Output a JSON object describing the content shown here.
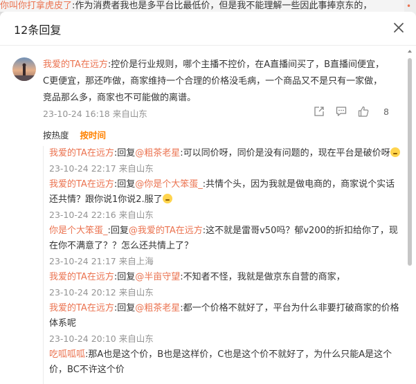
{
  "background": {
    "top_strip_name": "你叫你打拿虎皮了",
    "top_strip_text": ":作为消费者我也是多平台比最低价，但是我不能理解一些因此事捧京东的，"
  },
  "dialog": {
    "title": "12条回复"
  },
  "main_comment": {
    "user": "我爱的TA在远方",
    "text": ":控价是行业规则，哪个主播不控价，在A直播间买了，B直播间便宜，C更便宜，那还咋做，商家维持一个合理的价格没毛病，一个商品又不是只有一家做，竞品那么多，商家也不可能做的离谱。",
    "time": "23-10-24 16:18 来自山东",
    "like_count": "8"
  },
  "sort": {
    "hot_label": "按热度",
    "time_label": "按时间"
  },
  "replies": [
    {
      "user": "我爱的TA在远方",
      "reply_word": ":回复",
      "target": "@粗茶老星",
      "text": ":可以同价呀，同价是没有问题的，现在平台是破价呀",
      "emoji": true,
      "time": "23-10-24 22:17 来自山东"
    },
    {
      "user": "我爱的TA在远方",
      "reply_word": ":回复",
      "target": "@你是个大笨蛋_",
      "text": ":共情个头，因为我就是做电商的，商家说个实话还共情？跟你说1你说2.服了",
      "emoji": true,
      "time": "23-10-24 22:16 来自山东"
    },
    {
      "user": "你是个大笨蛋_",
      "reply_word": ":回复",
      "target": "@我爱的TA在远方",
      "text": ":这不就是雷哥v50吗？郁v200的折扣给你了，现在你不满意了？？怎么还共情上了？",
      "emoji": false,
      "time": "23-10-24 21:17 来自上海"
    },
    {
      "user": "我爱的TA在远方",
      "reply_word": ":回复",
      "target": "@半亩守望",
      "text": ":不知者不怪，我就是做京东自营的商家，",
      "emoji": false,
      "time": "23-10-24 20:12 来自山东"
    },
    {
      "user": "我爱的TA在远方",
      "reply_word": ":回复",
      "target": "@粗茶老星",
      "text": ":都一个价格不就好了，平台为什么非要打破商家的价格体系呢",
      "emoji": false,
      "time": "23-10-24 20:10 来自山东"
    },
    {
      "user": "吃呱呱呱",
      "reply_word": "",
      "target": "",
      "text": ":那A也是这个价，B也是这样价，C也是这个价不就好了，为什么只能A是这个价，BC不许这个价",
      "emoji": false,
      "time": ""
    }
  ],
  "colors": {
    "username": "#eb7350",
    "sort_active": "#ff8200",
    "meta": "#939393"
  },
  "icons": [
    "close-icon",
    "share-icon",
    "comment-icon",
    "like-icon"
  ]
}
